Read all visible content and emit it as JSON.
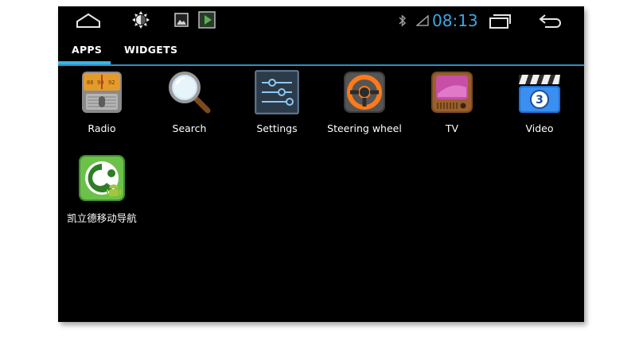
{
  "status_bar": {
    "clock": "08:13",
    "left_icons": [
      "home-outline-icon",
      "brightness-icon",
      "picture-icon",
      "media-play-icon"
    ],
    "right_icons": [
      "bluetooth-icon",
      "signal-icon",
      "recent-apps-icon",
      "back-icon"
    ]
  },
  "tabs": [
    {
      "label": "APPS",
      "selected": true
    },
    {
      "label": "WIDGETS",
      "selected": false
    }
  ],
  "apps": [
    {
      "label": "Radio",
      "icon": "radio-icon",
      "dial": [
        "88",
        "90",
        "92"
      ]
    },
    {
      "label": "Search",
      "icon": "magnifier-icon"
    },
    {
      "label": "Settings",
      "icon": "sliders-icon"
    },
    {
      "label": "Steering wheel",
      "icon": "steering-wheel-icon"
    },
    {
      "label": "TV",
      "icon": "tv-icon"
    },
    {
      "label": "Video",
      "icon": "clapperboard-icon",
      "badge": "3"
    },
    {
      "label": "凯立德移动导航",
      "icon": "navigation-app-icon"
    }
  ],
  "colors": {
    "accent": "#33b5e5",
    "background": "#000000",
    "clock": "#3aa8e4"
  }
}
